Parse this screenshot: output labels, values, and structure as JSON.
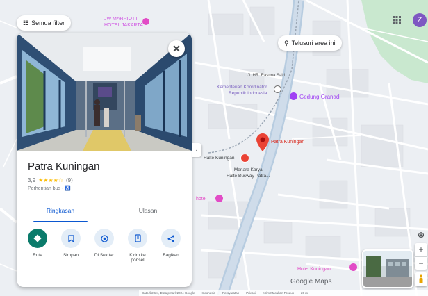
{
  "map": {
    "filter_chip": "Semua filter",
    "search_area_chip": "Telusuri area ini",
    "poi": {
      "marriott": "JW MARRIOTT\nHOTEL JAKARTA",
      "kementerian": "Kementerian Koordinator\nRepublik Indonesia",
      "gedung": "Gedung Granadi",
      "patra_kuningan_red": "Patra Kuningan",
      "halte_kuningan": "Halte Kuningan",
      "menara_karya": "Menara Karya\nHalte Busway Patra...",
      "hotel_left": "hotel",
      "hotel_bottom": "Hotel Kuningan",
      "street_top": "Jl. HR. Rasuna Said"
    },
    "attribution": {
      "google_maps": "Google Maps",
      "footer_items": [
        "Data ©2024, Data peta ©2024 Google",
        "Indonesia",
        "Persyaratan",
        "Privasi",
        "Kirim Masukan Produk",
        "20 m"
      ]
    }
  },
  "panel": {
    "title": "Patra Kuningan",
    "rating_value": "3,9",
    "stars": "★★★★☆",
    "review_count": "(9)",
    "subtitle": "Perhentian bus · ♿",
    "tabs": [
      {
        "label": "Ringkasan",
        "active": true
      },
      {
        "label": "Ulasan",
        "active": false
      }
    ],
    "actions": [
      {
        "label": "Rute",
        "icon": "directions-icon",
        "glyph": "◆",
        "primary": true
      },
      {
        "label": "Simpan",
        "icon": "bookmark-icon",
        "glyph": "❏",
        "primary": false
      },
      {
        "label": "Di Sekitar",
        "icon": "nearby-icon",
        "glyph": "◎",
        "primary": false
      },
      {
        "label": "Kirim ke ponsel",
        "icon": "send-to-phone-icon",
        "glyph": "▣",
        "primary": false
      },
      {
        "label": "Bagikan",
        "icon": "share-icon",
        "glyph": "<",
        "primary": false
      }
    ],
    "close_glyph": "✕"
  },
  "header": {
    "avatar_initial": "Z",
    "apps_glyph": "⋮⋮⋮"
  },
  "controls": {
    "locate_glyph": "⊕",
    "zoom_in": "+",
    "zoom_out": "−",
    "pegman": "♟"
  },
  "colors": {
    "accent_blue": "#0b57d0",
    "primary_action": "#0b7b6b",
    "pin_red": "#ea4335",
    "poi_purple": "#a142f4",
    "park_green": "#c8e6c9"
  }
}
